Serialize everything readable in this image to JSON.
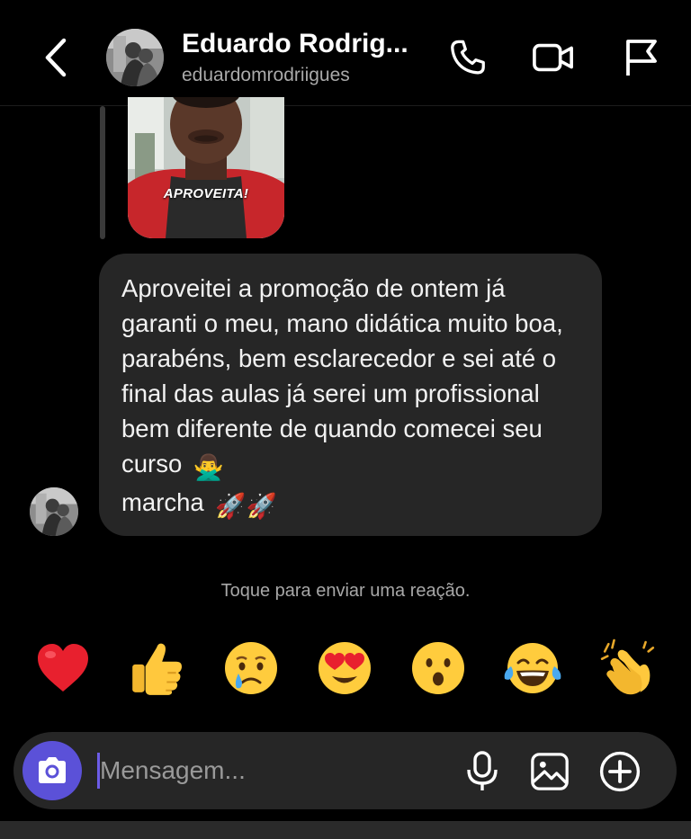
{
  "header": {
    "back_icon": "chevron-left-icon",
    "contact_name": "Eduardo Rodrig...",
    "contact_username": "eduardomrodriigues",
    "actions": [
      {
        "name": "audio-call",
        "icon": "phone-icon"
      },
      {
        "name": "video-call",
        "icon": "video-camera-icon"
      },
      {
        "name": "report",
        "icon": "flag-icon"
      }
    ]
  },
  "chat": {
    "story_reply": {
      "caption": "APROVEITA!"
    },
    "message": {
      "text": "Aproveitei a promoção de ontem já garanti o meu, mano didática muito boa, parabéns, bem esclarecedor e sei até o final das aulas já serei um profissional bem diferente de quando comecei seu curso",
      "emoji_after_text": "🙅‍♂️",
      "line_end": "marcha",
      "trailing_emojis": "🚀🚀"
    },
    "reaction_hint": "Toque para enviar uma reação.",
    "reactions": [
      "❤️",
      "👍",
      "😢",
      "😍",
      "😮",
      "😂",
      "👏"
    ]
  },
  "composer": {
    "placeholder": "Mensagem...",
    "value": "",
    "icons": [
      "camera-icon",
      "microphone-icon",
      "gallery-icon",
      "plus-circle-icon"
    ]
  },
  "colors": {
    "background": "#000000",
    "bubble": "#262626",
    "composer": "#262626",
    "camera_accent": "#5b51d8",
    "secondary_text": "#a9a9a9"
  }
}
